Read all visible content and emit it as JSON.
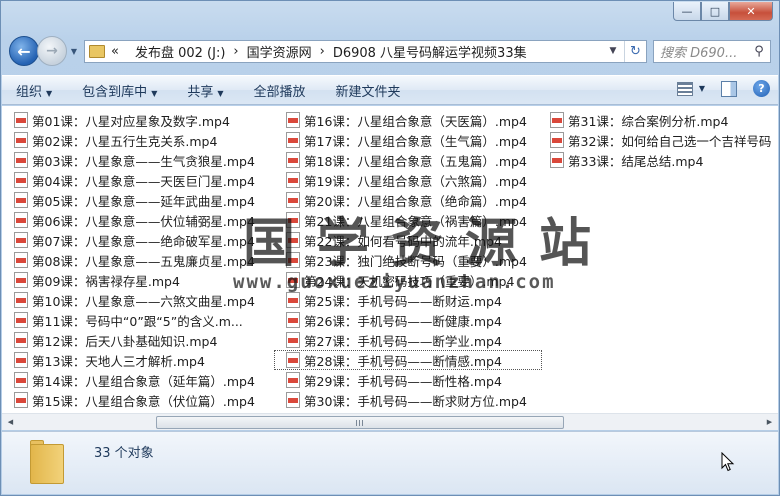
{
  "window": {
    "minimize": "—",
    "maximize": "□",
    "close": "✕"
  },
  "address": {
    "prefix": "«",
    "crumbs": [
      "发布盘 002 (J:)",
      "国学资源网",
      "D6908 八星号码解运学视频33集"
    ],
    "separator": "›",
    "search_placeholder": "搜索 D690..."
  },
  "toolbar": {
    "organize": "组织",
    "include_in_library": "包含到库中",
    "share": "共享",
    "play_all": "全部播放",
    "new_folder": "新建文件夹"
  },
  "files": {
    "column1": [
      "第01课：八星对应星象及数字.mp4",
      "第02课：八星五行生克关系.mp4",
      "第03课：八星象意——生气贪狼星.mp4",
      "第04课：八星象意——天医巨门星.mp4",
      "第05课：八星象意——延年武曲星.mp4",
      "第06课：八星象意——伏位辅弼星.mp4",
      "第07课：八星象意——绝命破军星.mp4",
      "第08课：八星象意——五鬼廉贞星.mp4",
      "第09课：祸害禄存星.mp4",
      "第10课：八星象意——六煞文曲星.mp4",
      "第11课：号码中“0”跟“5”的含义.m...",
      "第12课：后天八卦基础知识.mp4",
      "第13课：天地人三才解析.mp4",
      "第14课：八星组合象意（延年篇）.mp4",
      "第15课：八星组合象意（伏位篇）.mp4"
    ],
    "column2": [
      "第16课：八星组合象意（天医篇）.mp4",
      "第17课：八星组合象意（生气篇）.mp4",
      "第18课：八星组合象意（五鬼篇）.mp4",
      "第19课：八星组合象意（六煞篇）.mp4",
      "第20课：八星组合象意（绝命篇）.mp4",
      "第21课：八星组合象意（祸害篇）.mp4",
      "第22课：如何看号码中的流年.mp4",
      "第23课：独门绝技断号码（重要）.mp4",
      "第24课：天机密码技巧（重要）.mp4",
      "第25课：手机号码——断财运.mp4",
      "第26课：手机号码——断健康.mp4",
      "第27课：手机号码——断学业.mp4",
      "第28课：手机号码——断情感.mp4",
      "第29课：手机号码——断性格.mp4",
      "第30课：手机号码——断求财方位.mp4"
    ],
    "column3": [
      "第31课：综合案例分析.mp4",
      "第32课：如何给自己选一个吉祥号码",
      "第33课：结尾总结.mp4"
    ]
  },
  "watermark": {
    "title": "国学资源站",
    "url": "www.guoxueziyuanzhan.com"
  },
  "status": {
    "object_count": "33 个对象"
  },
  "scrollbar": {
    "left": "◀",
    "right": "▶",
    "position": 0.41
  }
}
